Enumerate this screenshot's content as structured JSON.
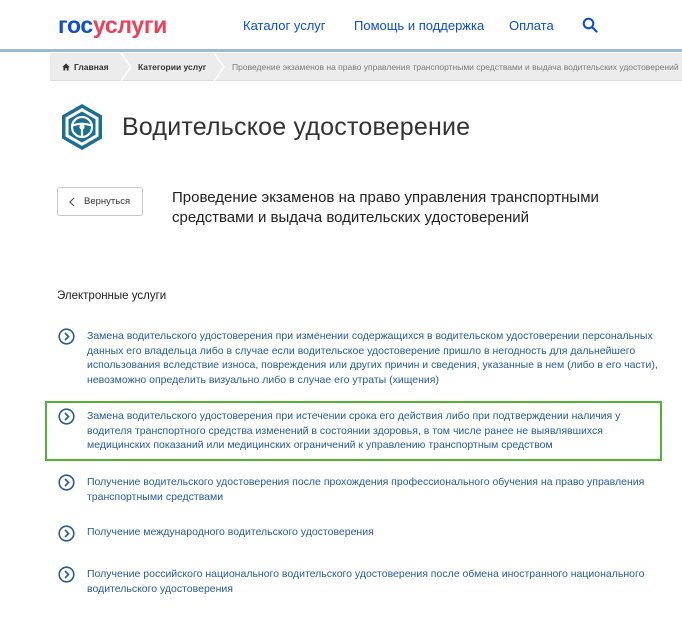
{
  "header": {
    "logo_part1": "гос",
    "logo_part2": "услуги",
    "nav": {
      "catalog": "Каталог услуг",
      "help": "Помощь и поддержка",
      "pay": "Оплата"
    },
    "search_icon": "search-icon"
  },
  "breadcrumb": {
    "home": "Главная",
    "category": "Категории услуг",
    "current": "Проведение экзаменов на право управления транспортными средствами и выдача водительских удостоверений"
  },
  "page": {
    "title": "Водительское удостоверение",
    "title_icon": "steering-wheel-icon",
    "back_label": "Вернуться",
    "subtitle": "Проведение экзаменов на право управления транспортными средствами и выдача водительских удостоверений"
  },
  "section": {
    "title": "Электронные услуги",
    "services": [
      {
        "label": "Замена водительского удостоверения при изменении содержащихся в водительском удостоверении персональных данных его владельца либо в случае если водительское удостоверение пришло в негодность для дальнейшего использования вследствие износа, повреждения или других причин и сведения, указанные в нем (либо в его части), невозможно определить визуально либо в случае его утраты (хищения)"
      },
      {
        "label": "Замена водительского удостоверения при истечении срока его действия либо при подтверждении наличия у водителя транспортного средства изменений в состоянии здоровья, в том числе ранее не выявлявшихся медицинских показаний или медицинских ограничений к управлению транспортным средством",
        "highlighted": true
      },
      {
        "label": "Получение водительского удостоверения после прохождения профессионального обучения на право управления транспортными средствами"
      },
      {
        "label": "Получение международного водительского удостоверения"
      },
      {
        "label": "Получение российского национального водительского удостоверения после обмена иностранного национального водительского удостоверения"
      }
    ]
  },
  "colors": {
    "brand_blue": "#0d4cd3",
    "brand_red": "#ee3f58",
    "link": "#2a5b95",
    "icon_teal": "#1c6f92",
    "highlight": "#55b035"
  }
}
